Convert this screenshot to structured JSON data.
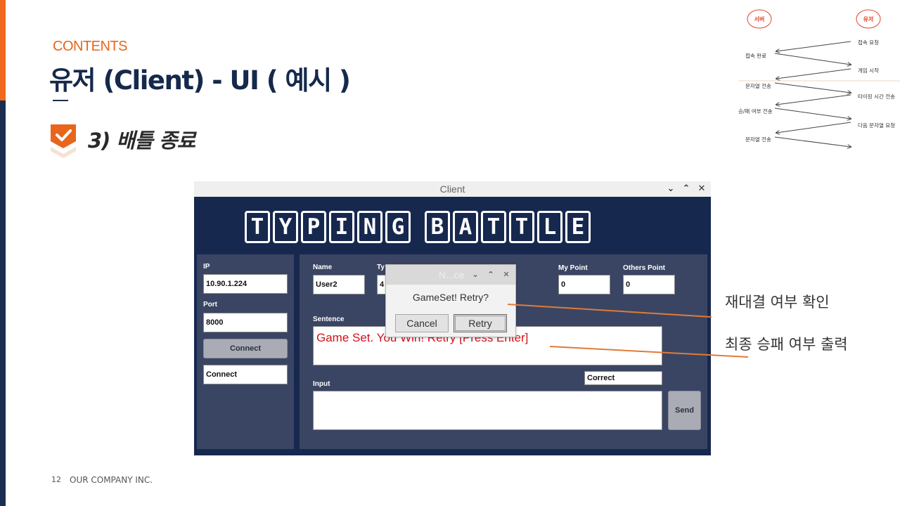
{
  "slide": {
    "section_label": "CONTENTS",
    "title": "유저 (Client) - UI ( 예시 )",
    "subtitle": "3) 배틀 종료",
    "page_number": "12",
    "company": "OUR COMPANY INC.",
    "accent_color": "#ef6a1c",
    "navy_color": "#1b2e52"
  },
  "sequence_diagram": {
    "server_label": "서버",
    "user_label": "유저",
    "steps": [
      "접속 요청",
      "접속 완료",
      "게임 시작",
      "문자열 전송",
      "타이핑 시간 전송",
      "승/패 여부 전송",
      "다음 문자열 요청",
      "문자열 전송"
    ]
  },
  "window": {
    "title": "Client",
    "controls": {
      "minimize": "⌄",
      "maximize": "⌃",
      "close": "✕"
    },
    "banner_letters": [
      "T",
      "Y",
      "P",
      "I",
      "N",
      "G",
      "",
      "B",
      "A",
      "T",
      "T",
      "L",
      "E"
    ],
    "left": {
      "ip_label": "IP",
      "ip_value": "10.90.1.224",
      "port_label": "Port",
      "port_value": "8000",
      "connect_button": "Connect",
      "status_value": "Connect"
    },
    "main": {
      "name_label": "Name",
      "name_value": "User2",
      "type_label": "Ty",
      "type_value": "4",
      "my_point_label": "My Point",
      "my_point_value": "0",
      "others_point_label": "Others Point",
      "others_point_value": "0",
      "sentence_label": "Sentence",
      "sentence_value": "Game Set. You Win!  Retry [Press Enter]",
      "result_value": "Correct",
      "input_label": "Input",
      "input_value": "",
      "send_button": "Send"
    }
  },
  "dialog": {
    "title": "N...ce",
    "message": "GameSet! Retry?",
    "cancel_button": "Cancel",
    "retry_button": "Retry"
  },
  "callouts": {
    "rematch": "재대결 여부 확인",
    "result": "최종 승패 여부 출력"
  }
}
